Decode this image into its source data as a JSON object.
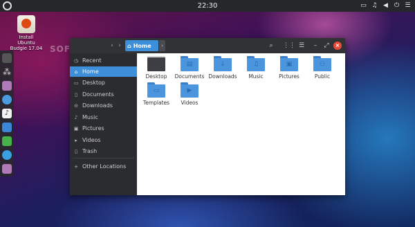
{
  "panel": {
    "clock": "22:30",
    "tray_icons": [
      "window-icon",
      "bell-icon",
      "volume-icon",
      "power-icon",
      "menu-icon"
    ]
  },
  "desktop_icon": {
    "label_line1": "Install",
    "label_line2": "Ubuntu",
    "label_line3": "Budgie 17.04"
  },
  "watermark": "SOFTPEDIA",
  "window": {
    "location": "Home",
    "sidebar": [
      {
        "label": "Recent",
        "icon": "clock-icon"
      },
      {
        "label": "Home",
        "icon": "home-icon",
        "active": true
      },
      {
        "label": "Desktop",
        "icon": "desktop-icon"
      },
      {
        "label": "Documents",
        "icon": "document-icon"
      },
      {
        "label": "Downloads",
        "icon": "download-icon"
      },
      {
        "label": "Music",
        "icon": "music-icon"
      },
      {
        "label": "Pictures",
        "icon": "picture-icon"
      },
      {
        "label": "Videos",
        "icon": "video-icon"
      },
      {
        "label": "Trash",
        "icon": "trash-icon"
      },
      {
        "label": "Other Locations",
        "icon": "plus-icon"
      }
    ],
    "files": [
      {
        "name": "Desktop"
      },
      {
        "name": "Documents"
      },
      {
        "name": "Downloads"
      },
      {
        "name": "Music"
      },
      {
        "name": "Pictures"
      },
      {
        "name": "Public"
      },
      {
        "name": "Templates"
      },
      {
        "name": "Videos"
      }
    ]
  },
  "colors": {
    "accent": "#3e8fd9",
    "titlebar": "#313236",
    "sidebar": "#2b2c30",
    "close": "#e74b3c",
    "folder": "#4a95dd"
  }
}
